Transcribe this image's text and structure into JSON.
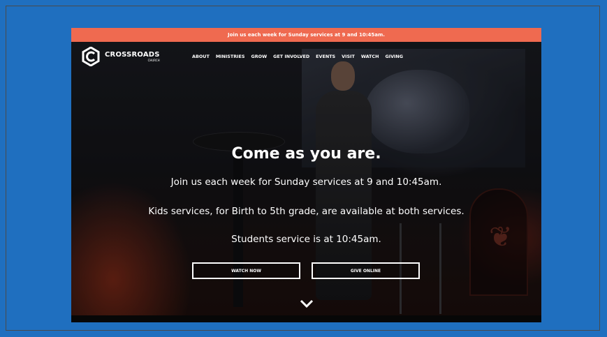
{
  "announcement": "Join us each week for Sunday services at 9 and 10:45am.",
  "logo": {
    "name": "CROSSROADS",
    "sub": "CHURCH"
  },
  "nav": [
    "ABOUT",
    "MINISTRIES",
    "GROW",
    "GET INVOLVED",
    "EVENTS",
    "VISIT",
    "WATCH",
    "GIVING"
  ],
  "hero": {
    "headline": "Come as you are.",
    "line1": "Join us each week for Sunday services at 9 and 10:45am.",
    "line2": "Kids services, for Birth to 5th grade, are available at both services.",
    "line3": "Students service is at 10:45am."
  },
  "buttons": {
    "watch": "WATCH NOW",
    "give": "GIVE ONLINE"
  },
  "colors": {
    "background": "#1f6fbf",
    "announcement_bar": "#ef6a50"
  },
  "icons": {
    "scroll_down": "chevron-down-icon",
    "logo": "crossroads-logo-icon"
  }
}
